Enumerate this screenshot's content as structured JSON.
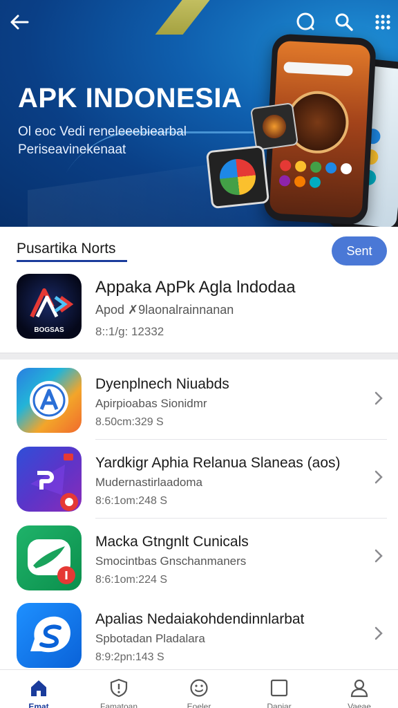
{
  "header": {
    "title": "APK INDONESIA",
    "subtitle_line1": "Ol eoc Vedi reneleeebiearbal",
    "subtitle_line2": "Periseavinekenaat"
  },
  "section": {
    "title": "Pusartika Norts",
    "button_label": "Sent"
  },
  "featured": {
    "title": "Appaka ApPk Agla lndodaa",
    "subtitle": "Apod ✗9laonalrainnanan",
    "meta": "8::1/g: 12332",
    "icon_text": "BOGSAS",
    "icon": "apk-logo-icon"
  },
  "apps": [
    {
      "title": "Dyenplnech Niuabds",
      "subtitle": "Apirpioabas Sionidmr",
      "meta": "8.50cm:329 S",
      "icon": "a-logo-icon"
    },
    {
      "title": "Yardkigr Aphia Relanua Slaneas (aos)",
      "subtitle": "Mudernastirlaadoma",
      "meta": "8:6:1om:248 S",
      "icon": "p-logo-icon"
    },
    {
      "title": "Macka Gtngnlt Cunicals",
      "subtitle": "Smocintbas Gnschanmaners",
      "meta": "8:6:1om:224 S",
      "icon": "chat-logo-icon"
    },
    {
      "title": "Apalias Nedaiakohdendinnlarbat",
      "subtitle": "Spbotadan Pladalara",
      "meta": "8:9:2pn:143 S",
      "icon": "s-logo-icon"
    }
  ],
  "nav": [
    {
      "label": "Emat",
      "icon": "home-icon",
      "active": true
    },
    {
      "label": "Famatoan",
      "icon": "shield-icon",
      "active": false
    },
    {
      "label": "Eoeler",
      "icon": "face-icon",
      "active": false
    },
    {
      "label": "Dapiar",
      "icon": "square-icon",
      "active": false
    },
    {
      "label": "Vaeae",
      "icon": "person-icon",
      "active": false
    }
  ],
  "colors": {
    "accent": "#1a3c9c",
    "button": "#4a78d6",
    "hero_dark": "#07306b",
    "hero_light": "#1f8fd6"
  }
}
